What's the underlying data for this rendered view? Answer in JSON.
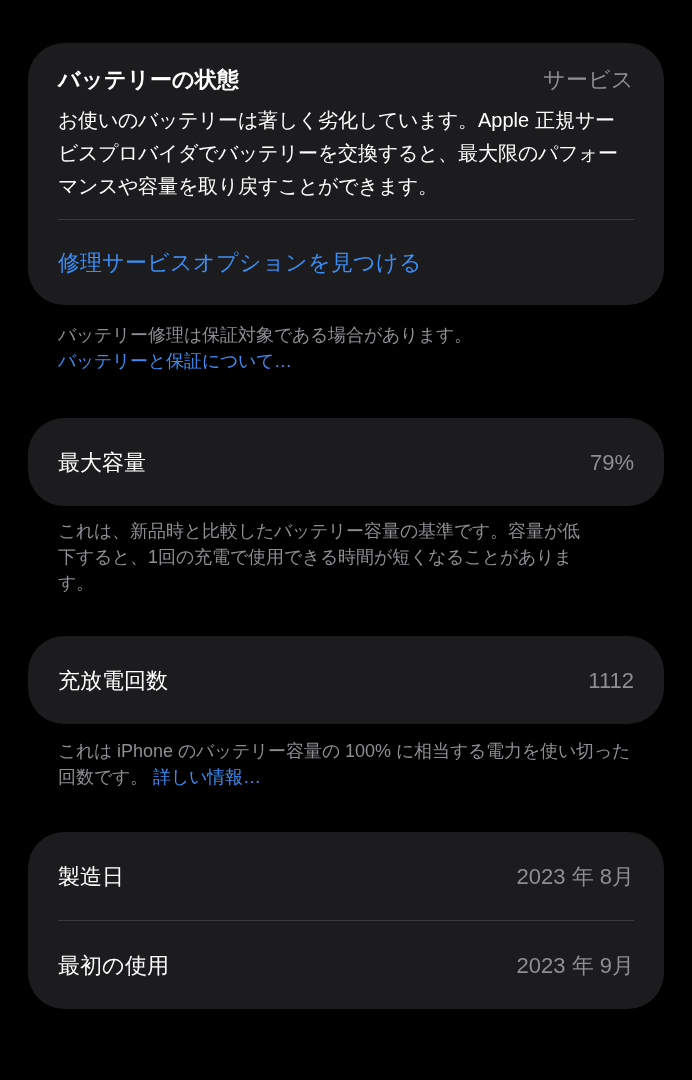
{
  "battery_health": {
    "title": "バッテリーの状態",
    "status": "サービス",
    "description": "お使いのバッテリーは著しく劣化しています。Apple 正規サービスプロバイダでバッテリーを交換すると、最大限のパフォーマンスや容量を取り戻すことができます。",
    "action": "修理サービスオプションを見つける"
  },
  "warranty_note": {
    "text": "バッテリー修理は保証対象である場合があります。",
    "link": "バッテリーと保証について…"
  },
  "max_capacity": {
    "label": "最大容量",
    "value": "79%"
  },
  "capacity_note": {
    "text": "これは、新品時と比較したバッテリー容量の基準です。容量が低下すると、1回の充電で使用できる時間が短くなることがあります。"
  },
  "cycle_count": {
    "label": "充放電回数",
    "value": "1112"
  },
  "cycle_note": {
    "text": "これは iPhone のバッテリー容量の 100% に相当する電力を使い切った回数です。",
    "link": "詳しい情報…"
  },
  "dates": [
    {
      "label": "製造日",
      "value": "2023 年 8月"
    },
    {
      "label": "最初の使用",
      "value": "2023 年 9月"
    }
  ]
}
